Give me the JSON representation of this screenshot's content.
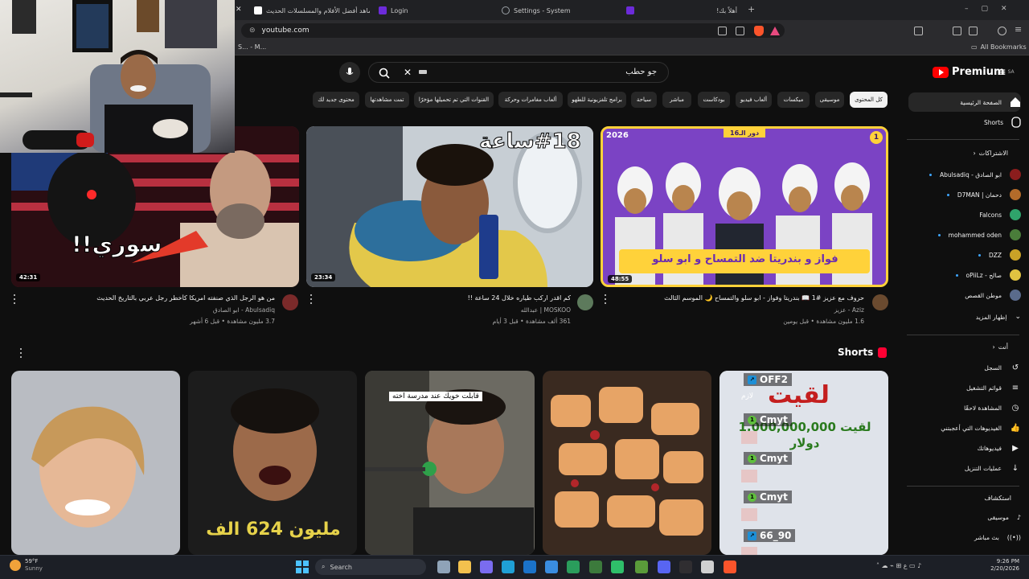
{
  "browser": {
    "tabs": [
      {
        "label": "شاهد أفضل الأفلام والمسلسلات الحديث",
        "color": "#ffffff"
      },
      {
        "label": "Login",
        "color": "#6c2bd9"
      },
      {
        "label": "Settings - System",
        "color": "#9aa0a6"
      },
      {
        "label": "أهلاً بك!",
        "color": "#53fc18"
      }
    ],
    "new_tab": "+",
    "url": "youtube.com",
    "bookmarks_left": "S... - M...",
    "bookmarks_right": "All Bookmarks"
  },
  "youtube": {
    "logo_text": "Premium",
    "logo_region": "SA",
    "search_query": "جو حطب",
    "chips": [
      {
        "label": "كل المحتوى",
        "active": true
      },
      {
        "label": "موسيقى",
        "active": false
      },
      {
        "label": "ميكسات",
        "active": false
      },
      {
        "label": "ألعاب فيديو",
        "active": false
      },
      {
        "label": "بودكاست",
        "active": false
      },
      {
        "label": "مباشر",
        "active": false
      },
      {
        "label": "سياحة",
        "active": false
      },
      {
        "label": "برامج تلفزيونية للطهو",
        "active": false
      },
      {
        "label": "ألعاب مغامرات وحركة",
        "active": false
      },
      {
        "label": "القنوات التي تم تحميلها مؤخرًا",
        "active": false
      },
      {
        "label": "تمت مشاهدتها",
        "active": false
      },
      {
        "label": "محتوى جديد لك",
        "active": false
      }
    ],
    "videos": [
      {
        "title": "حروف مع عزيز #1 📖 بندريتا وفواز - ابو سلو والتمساح 🌙 الموسم الثالث",
        "channel": "Aziz - عزيز",
        "meta": "1.6 مليون مشاهدة • قبل يومين",
        "duration": "48:55",
        "thumb_text_top": "2026",
        "thumb_text_banner": "فواز و بندريتا ضد التمساح و ابو سلو",
        "thumb_text_badge": "دور الـ16",
        "thumb_number": "1"
      },
      {
        "title": "كم اقدر اركب طياره خلال 24 ساعة !!",
        "channel": "MOSKOO | عبدالله",
        "meta": "361 ألف مشاهدة • قبل 3 أيام",
        "duration": "23:34",
        "thumb_text_top": "#18ساعة"
      },
      {
        "title": "من هو الرجل الذي صنفته امريكا كأخطر رجل عربي بالتاريخ الحديث",
        "channel": "Abulsadiq - ابو الصادق",
        "meta": "3.7 مليون مشاهدة • قبل 6 أشهر",
        "duration": "42:31",
        "thumb_text_top": "سوري!!"
      }
    ],
    "shorts": {
      "header": "Shorts",
      "cards": [
        {
          "overlay": "لقيت 1,000,000,000 دولار"
        },
        {
          "overlay": ""
        },
        {
          "overlay": "مليون 624 الف"
        },
        {
          "overlay": "قابلت خويك عند مدرسة اخته"
        },
        {
          "overlay": ""
        }
      ]
    },
    "sidebar": {
      "home": "الصفحة الرئيسية",
      "shorts": "Shorts",
      "subscriptions_header": "الاشتراكات",
      "subscriptions": [
        {
          "name": "Abulsadiq - ابو الصادق",
          "color": "#8b1d1d",
          "live": true
        },
        {
          "name": "D7MAN | دحمان",
          "color": "#b36b2a",
          "live": true
        },
        {
          "name": "Falcons",
          "color": "#2fa36b",
          "live": false
        },
        {
          "name": "mohammed oden",
          "color": "#4a7d3a",
          "live": true
        },
        {
          "name": "DZZ",
          "color": "#c9a227",
          "live": true
        },
        {
          "name": "oPiiLz - صالح",
          "color": "#e0c341",
          "live": true
        },
        {
          "name": "موطن القصص",
          "color": "#5a6b8c",
          "live": false
        }
      ],
      "show_more": "إظهار المزيد",
      "you_header": "أنت",
      "you_items": [
        "السجل",
        "قوائم التشغيل",
        "المشاهدة لاحقًا",
        "الفيديوهات التي أعجبتني",
        "فيديوهاتك",
        "عمليات التنزيل"
      ],
      "explore_header": "استكشاف",
      "explore_items": [
        "موسيقى",
        "بث مباشر"
      ]
    }
  },
  "chat_overlay": [
    {
      "name": "OFF2",
      "badge": "blue",
      "sub": "لازم"
    },
    {
      "name": "Cmyt",
      "badge": "green",
      "sub": ""
    },
    {
      "name": "Cmyt",
      "badge": "green",
      "sub": ""
    },
    {
      "name": "Cmyt",
      "badge": "green",
      "sub": ""
    },
    {
      "name": "66_90",
      "badge": "blue",
      "sub": ""
    }
  ],
  "taskbar": {
    "weather_temp": "59°F",
    "weather_desc": "Sunny",
    "search_label": "Search",
    "time": "9:26 PM",
    "date": "2/20/2026"
  }
}
